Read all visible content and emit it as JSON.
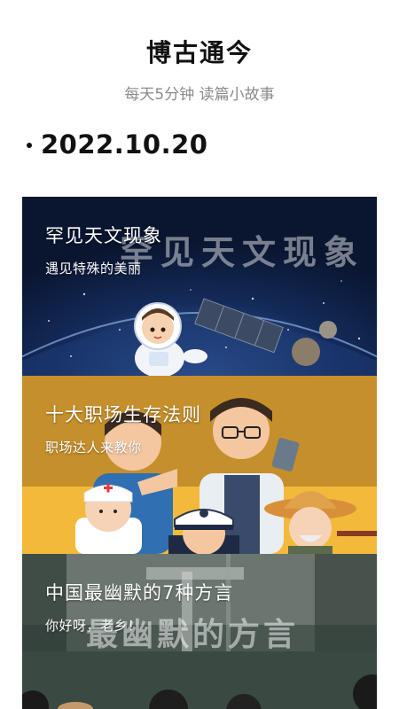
{
  "header": {
    "title": "博古通今",
    "subtitle": "每天5分钟 读篇小故事"
  },
  "date": "2022.10.20",
  "cards": [
    {
      "title": "罕见天文现象",
      "subtitle": "遇见特殊的美丽",
      "image_caption": "罕见天文现象",
      "image_icon": "astronaut-satellite-illustration"
    },
    {
      "title": "十大职场生存法则",
      "subtitle": "职场达人来教你",
      "image_icon": "professions-illustration"
    },
    {
      "title": "中国最幽默的7种方言",
      "subtitle": "你好呀，老乡！",
      "image_caption": "最幽默的方言",
      "image_icon": "people-photo"
    }
  ],
  "colors": {
    "accent_yellow": "#c58f2b",
    "space_navy": "#0c1a36"
  }
}
